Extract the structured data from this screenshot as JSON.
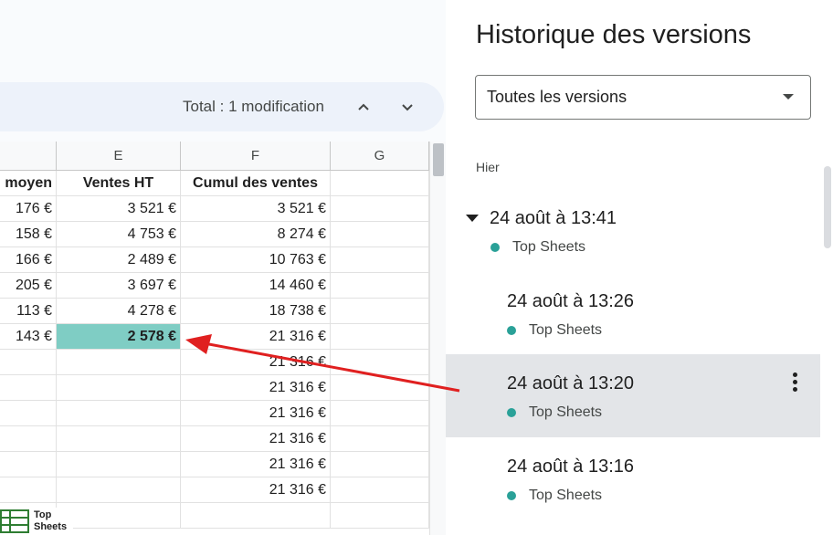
{
  "toolbar": {
    "change_total": "Total : 1 modification",
    "prev_icon": "chevron-up-icon",
    "next_icon": "chevron-down-icon"
  },
  "columns": [
    "E",
    "F",
    "G"
  ],
  "table": {
    "headers": {
      "d": "moyen",
      "e": "Ventes HT",
      "f": "Cumul des ventes"
    },
    "rows": [
      {
        "d": "176 €",
        "e": "3 521 €",
        "f": "3 521 €"
      },
      {
        "d": "158 €",
        "e": "4 753 €",
        "f": "8 274 €"
      },
      {
        "d": "166 €",
        "e": "2 489 €",
        "f": "10 763 €"
      },
      {
        "d": "205 €",
        "e": "3 697 €",
        "f": "14 460 €"
      },
      {
        "d": "113 €",
        "e": "4 278 €",
        "f": "18 738 €"
      },
      {
        "d": "143 €",
        "e": "2 578 €",
        "f": "21 316 €"
      },
      {
        "d": "",
        "e": "",
        "f": "21 316 €"
      },
      {
        "d": "",
        "e": "",
        "f": "21 316 €"
      },
      {
        "d": "",
        "e": "",
        "f": "21 316 €"
      },
      {
        "d": "",
        "e": "",
        "f": "21 316 €"
      },
      {
        "d": "",
        "e": "",
        "f": "21 316 €"
      },
      {
        "d": "",
        "e": "",
        "f": "21 316 €"
      },
      {
        "d": "",
        "e": "",
        "f": ""
      }
    ]
  },
  "highlight_color": "#7fcdc4",
  "arrow_color": "#e02020",
  "logo": {
    "line1": "Top",
    "line2": "Sheets"
  },
  "panel": {
    "title": "Historique des versions",
    "filter_value": "Toutes les versions",
    "section_label": "Hier",
    "versions": [
      {
        "date": "24 août à 13:41",
        "author": "Top Sheets"
      },
      {
        "date": "24 août à 13:26",
        "author": "Top Sheets"
      },
      {
        "date": "24 août à 13:20",
        "author": "Top Sheets"
      },
      {
        "date": "24 août à 13:16",
        "author": "Top Sheets"
      }
    ],
    "author_color": "#2aa198",
    "selected_bg": "#e3e5e8"
  }
}
